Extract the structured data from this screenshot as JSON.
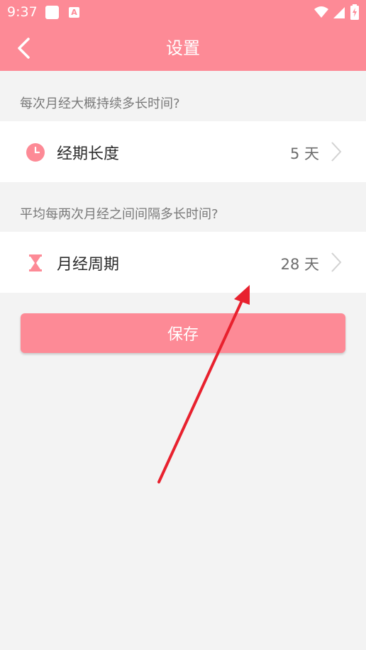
{
  "status_bar": {
    "time": "9:37",
    "a_icon_text": "A"
  },
  "app_bar": {
    "title": "设置"
  },
  "sections": [
    {
      "hint": "每次月经大概持续多长时间?",
      "row": {
        "label": "经期长度",
        "value": "5 天",
        "icon": "clock-icon"
      }
    },
    {
      "hint": "平均每两次月经之间间隔多长时间?",
      "row": {
        "label": "月经周期",
        "value": "28 天",
        "icon": "hourglass-icon"
      }
    }
  ],
  "save_button": {
    "label": "保存"
  },
  "colors": {
    "accent": "#fd8a96",
    "annotation_arrow": "#e8212e"
  }
}
